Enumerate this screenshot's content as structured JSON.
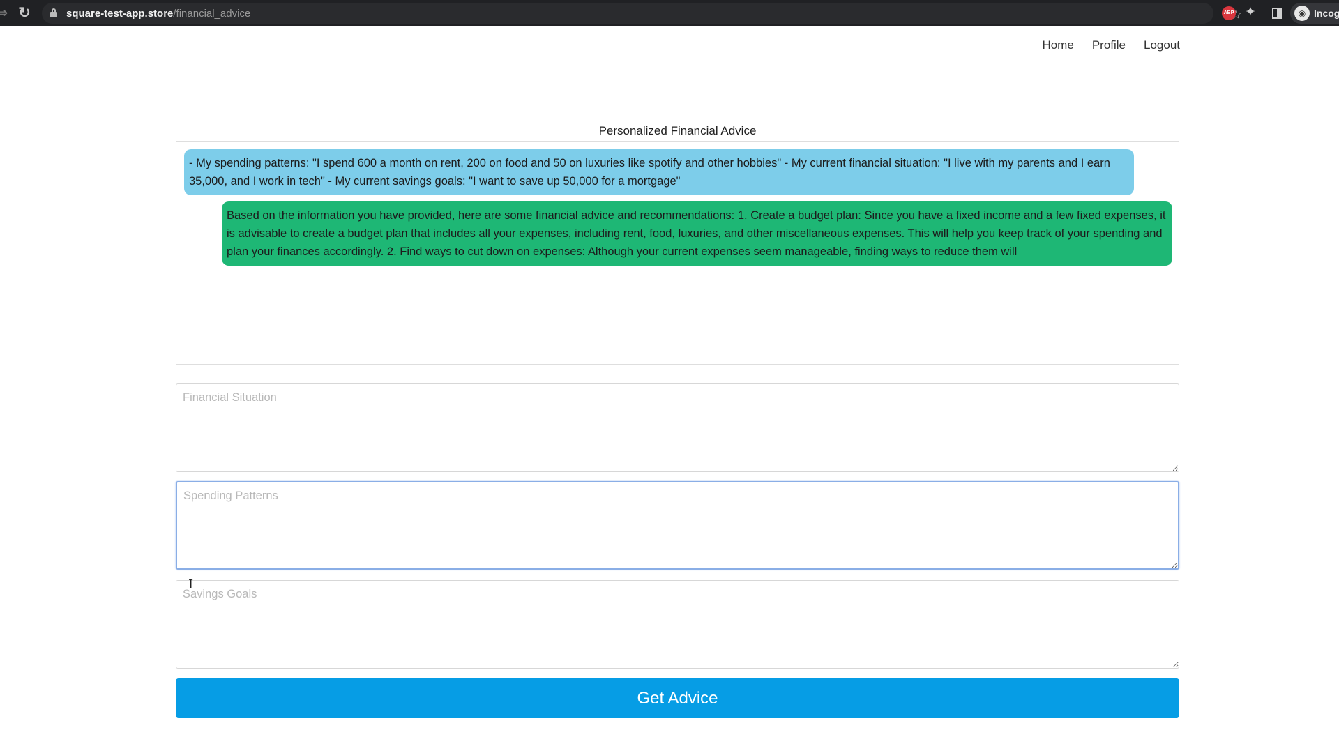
{
  "browser": {
    "url_host": "square-test-app.store",
    "url_path": "/financial_advice",
    "icons": {
      "back": "arrow-right-icon",
      "reload": "reload-icon",
      "lock": "lock-icon",
      "bookmark": "star-icon",
      "adblock": "abp-icon",
      "extensions": "puzzle-icon",
      "side_panel": "side-panel-icon",
      "profile": "incognito-icon"
    },
    "adblock_label": "ABP",
    "profile_label": "Incog"
  },
  "nav": {
    "items": [
      {
        "label": "Home"
      },
      {
        "label": "Profile"
      },
      {
        "label": "Logout"
      }
    ]
  },
  "page": {
    "title": "Personalized Financial Advice"
  },
  "chat": {
    "messages": [
      {
        "role": "user",
        "text": "- My spending patterns: \"I spend 600 a month on rent, 200 on food and 50 on luxuries like spotify and other hobbies\" - My current financial situation: \"I live with my parents and I earn 35,000, and I work in tech\" - My current savings goals: \"I want to save up 50,000 for a mortgage\""
      },
      {
        "role": "assistant",
        "text": "Based on the information you have provided, here are some financial advice and recommendations: 1. Create a budget plan: Since you have a fixed income and a few fixed expenses, it is advisable to create a budget plan that includes all your expenses, including rent, food, luxuries, and other miscellaneous expenses. This will help you keep track of your spending and plan your finances accordingly. 2. Find ways to cut down on expenses: Although your current expenses seem manageable, finding ways to reduce them will"
      }
    ],
    "colors": {
      "user_bubble": "#7dcdea",
      "assistant_bubble": "#1eb775"
    }
  },
  "form": {
    "financial_situation": {
      "value": "",
      "placeholder": "Financial Situation"
    },
    "spending_patterns": {
      "value": "",
      "placeholder": "Spending Patterns"
    },
    "savings_goals": {
      "value": "",
      "placeholder": "Savings Goals"
    },
    "submit_label": "Get Advice",
    "accent_color": "#069de5"
  }
}
